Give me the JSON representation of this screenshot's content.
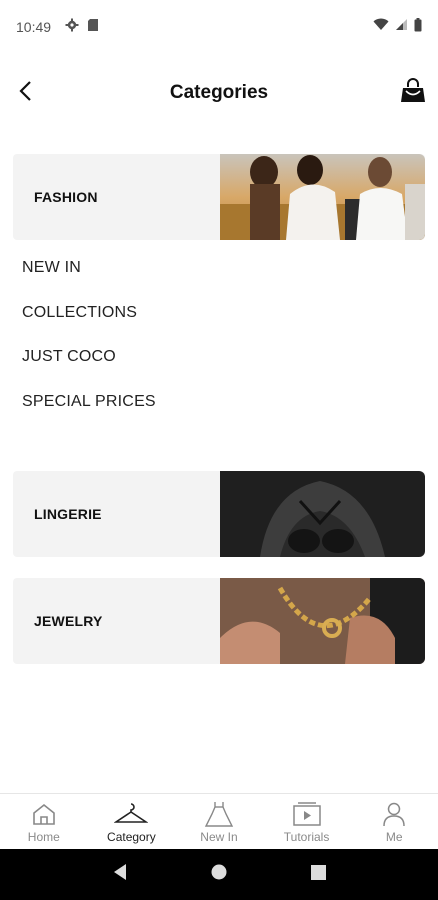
{
  "status_bar": {
    "time": "10:49",
    "icons": [
      "gear-icon",
      "sim-card-icon",
      "wifi-icon",
      "signal-icon",
      "battery-icon"
    ]
  },
  "header": {
    "title": "Categories",
    "back_icon": "chevron-left-icon",
    "bag_icon": "shopping-bag-icon"
  },
  "categories": [
    {
      "label": "FASHION",
      "subcategories": [
        "NEW IN",
        "COLLECTIONS",
        "JUST COCO",
        "SPECIAL PRICES"
      ]
    },
    {
      "label": "LINGERIE"
    },
    {
      "label": "JEWELRY"
    }
  ],
  "bottom_nav": {
    "items": [
      {
        "label": "Home",
        "icon": "home-icon"
      },
      {
        "label": "Category",
        "icon": "hanger-icon",
        "active": true
      },
      {
        "label": "New In",
        "icon": "dress-icon"
      },
      {
        "label": "Tutorials",
        "icon": "video-icon"
      },
      {
        "label": "Me",
        "icon": "person-icon"
      }
    ]
  },
  "colors": {
    "card_background": "#f3f3f3",
    "text_primary": "#111111",
    "nav_inactive": "#8a8a8a",
    "system_nav": "#000000"
  }
}
